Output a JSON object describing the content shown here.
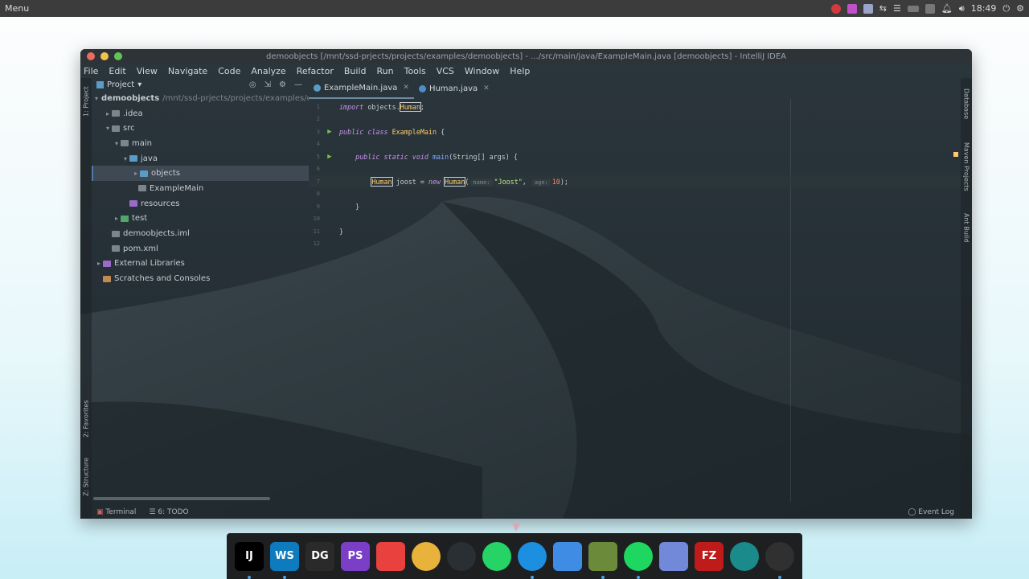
{
  "system_bar": {
    "menu_label": "Menu",
    "clock": "18:49"
  },
  "window": {
    "title": "demoobjects [/mnt/ssd-prjects/projects/examples/demoobjects] - .../src/main/java/ExampleMain.java [demoobjects] - IntelliJ IDEA"
  },
  "menu": [
    "File",
    "Edit",
    "View",
    "Navigate",
    "Code",
    "Analyze",
    "Refactor",
    "Build",
    "Run",
    "Tools",
    "VCS",
    "Window",
    "Help"
  ],
  "left_tool_tabs": [
    "1: Project",
    "2: Favorites",
    "Z: Structure"
  ],
  "right_tool_tabs": [
    "Database",
    "Maven Projects",
    "Ant Build"
  ],
  "project_panel": {
    "title": "Project",
    "tree": [
      {
        "label": "demoobjects",
        "path": "/mnt/ssd-prjects/projects/examples/de",
        "depth": 0,
        "arrow": "▾",
        "bold": true
      },
      {
        "label": ".idea",
        "depth": 1,
        "arrow": "▸"
      },
      {
        "label": "src",
        "depth": 1,
        "arrow": "▾"
      },
      {
        "label": "main",
        "depth": 2,
        "arrow": "▾"
      },
      {
        "label": "java",
        "depth": 3,
        "arrow": "▾"
      },
      {
        "label": "objects",
        "depth": 4,
        "arrow": "▸",
        "selected": true
      },
      {
        "label": "ExampleMain",
        "depth": 4,
        "arrow": ""
      },
      {
        "label": "resources",
        "depth": 3,
        "arrow": ""
      },
      {
        "label": "test",
        "depth": 2,
        "arrow": "▸"
      },
      {
        "label": "demoobjects.iml",
        "depth": 1,
        "arrow": ""
      },
      {
        "label": "pom.xml",
        "depth": 1,
        "arrow": ""
      },
      {
        "label": "External Libraries",
        "depth": 0,
        "arrow": "▸"
      },
      {
        "label": "Scratches and Consoles",
        "depth": 0,
        "arrow": ""
      }
    ]
  },
  "editor": {
    "tabs": [
      {
        "label": "ExampleMain.java",
        "active": true
      },
      {
        "label": "Human.java",
        "active": false
      }
    ],
    "line_numbers": [
      "1",
      "2",
      "3",
      "4",
      "5",
      "6",
      "7",
      "8",
      "9",
      "10",
      "11",
      "12"
    ],
    "code": {
      "import_kw": "import",
      "import_pkg": "objects.",
      "import_cls": "Human",
      "import_end": ";",
      "public": "public",
      "class_kw": "class",
      "class_name": "ExampleMain",
      "open_brace": "{",
      "static_kw": "static",
      "void_kw": "void",
      "main_fn": "main",
      "main_args": "(String[] args) {",
      "type": "Human",
      "var": "joost",
      "assign": "=",
      "new_kw": "new",
      "ctor": "Human",
      "paren_open": "(",
      "hint_name": "name:",
      "arg_str": "\"Joost\"",
      "comma": ",",
      "hint_age": "age:",
      "arg_num": "10",
      "stmt_end": ");",
      "close_inner": "}",
      "close_outer": "}"
    }
  },
  "status_bar": {
    "terminal": "Terminal",
    "todo": "6: TODO",
    "event_log": "Event Log"
  },
  "dock": {
    "items": [
      {
        "name": "intellij",
        "label": "IJ",
        "color": "#000000"
      },
      {
        "name": "webstorm",
        "label": "WS",
        "color": "#0d7bbd"
      },
      {
        "name": "datagrip",
        "label": "DG",
        "color": "#2a2a2a"
      },
      {
        "name": "phpstorm",
        "label": "PS",
        "color": "#7b3ec7"
      },
      {
        "name": "jetbrains-toolbox",
        "label": "",
        "color": "#e8413e"
      },
      {
        "name": "chrome",
        "label": "",
        "color": "#e9b23a"
      },
      {
        "name": "headset",
        "label": "",
        "color": "#2a2f33"
      },
      {
        "name": "whatsapp",
        "label": "",
        "color": "#25d366"
      },
      {
        "name": "timer",
        "label": "",
        "color": "#1d8fe0"
      },
      {
        "name": "finder",
        "label": "",
        "color": "#3e8ce4"
      },
      {
        "name": "minecraft",
        "label": "",
        "color": "#6b8a3a"
      },
      {
        "name": "spotify",
        "label": "",
        "color": "#1ed760"
      },
      {
        "name": "discord",
        "label": "",
        "color": "#7289da"
      },
      {
        "name": "filezilla",
        "label": "FZ",
        "color": "#bf1b1b"
      },
      {
        "name": "gitkraken",
        "label": "",
        "color": "#1b8a8a"
      },
      {
        "name": "obs",
        "label": "",
        "color": "#303030"
      }
    ]
  }
}
